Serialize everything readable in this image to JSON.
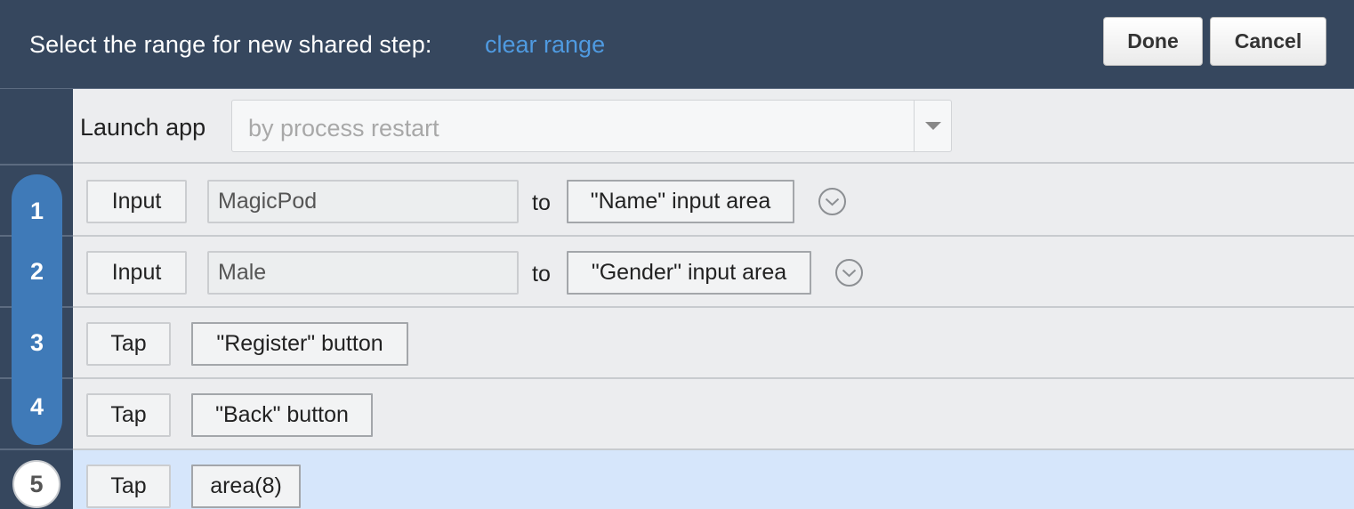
{
  "header": {
    "title": "Select the range for new shared step:",
    "clear_range": "clear range",
    "done_label": "Done",
    "cancel_label": "Cancel"
  },
  "launch": {
    "label": "Launch app",
    "select_value": "by process restart"
  },
  "steps": [
    {
      "number": "1",
      "command": "Input",
      "value": "MagicPod",
      "connector": "to",
      "target": "\"Name\" input area"
    },
    {
      "number": "2",
      "command": "Input",
      "value": "Male",
      "connector": "to",
      "target": "\"Gender\" input area"
    },
    {
      "number": "3",
      "command": "Tap",
      "target": "\"Register\" button"
    },
    {
      "number": "4",
      "command": "Tap",
      "target": "\"Back\" button"
    },
    {
      "number": "5",
      "command": "Tap",
      "target": "area(8)"
    }
  ],
  "icons": {
    "dropdown": "caret-down-icon",
    "expand": "chevron-down-circle-icon"
  },
  "colors": {
    "header_bg": "#36475e",
    "link": "#4f9ae0",
    "range_pill": "#3f7ab8",
    "highlight_row": "#d6e6fb"
  }
}
